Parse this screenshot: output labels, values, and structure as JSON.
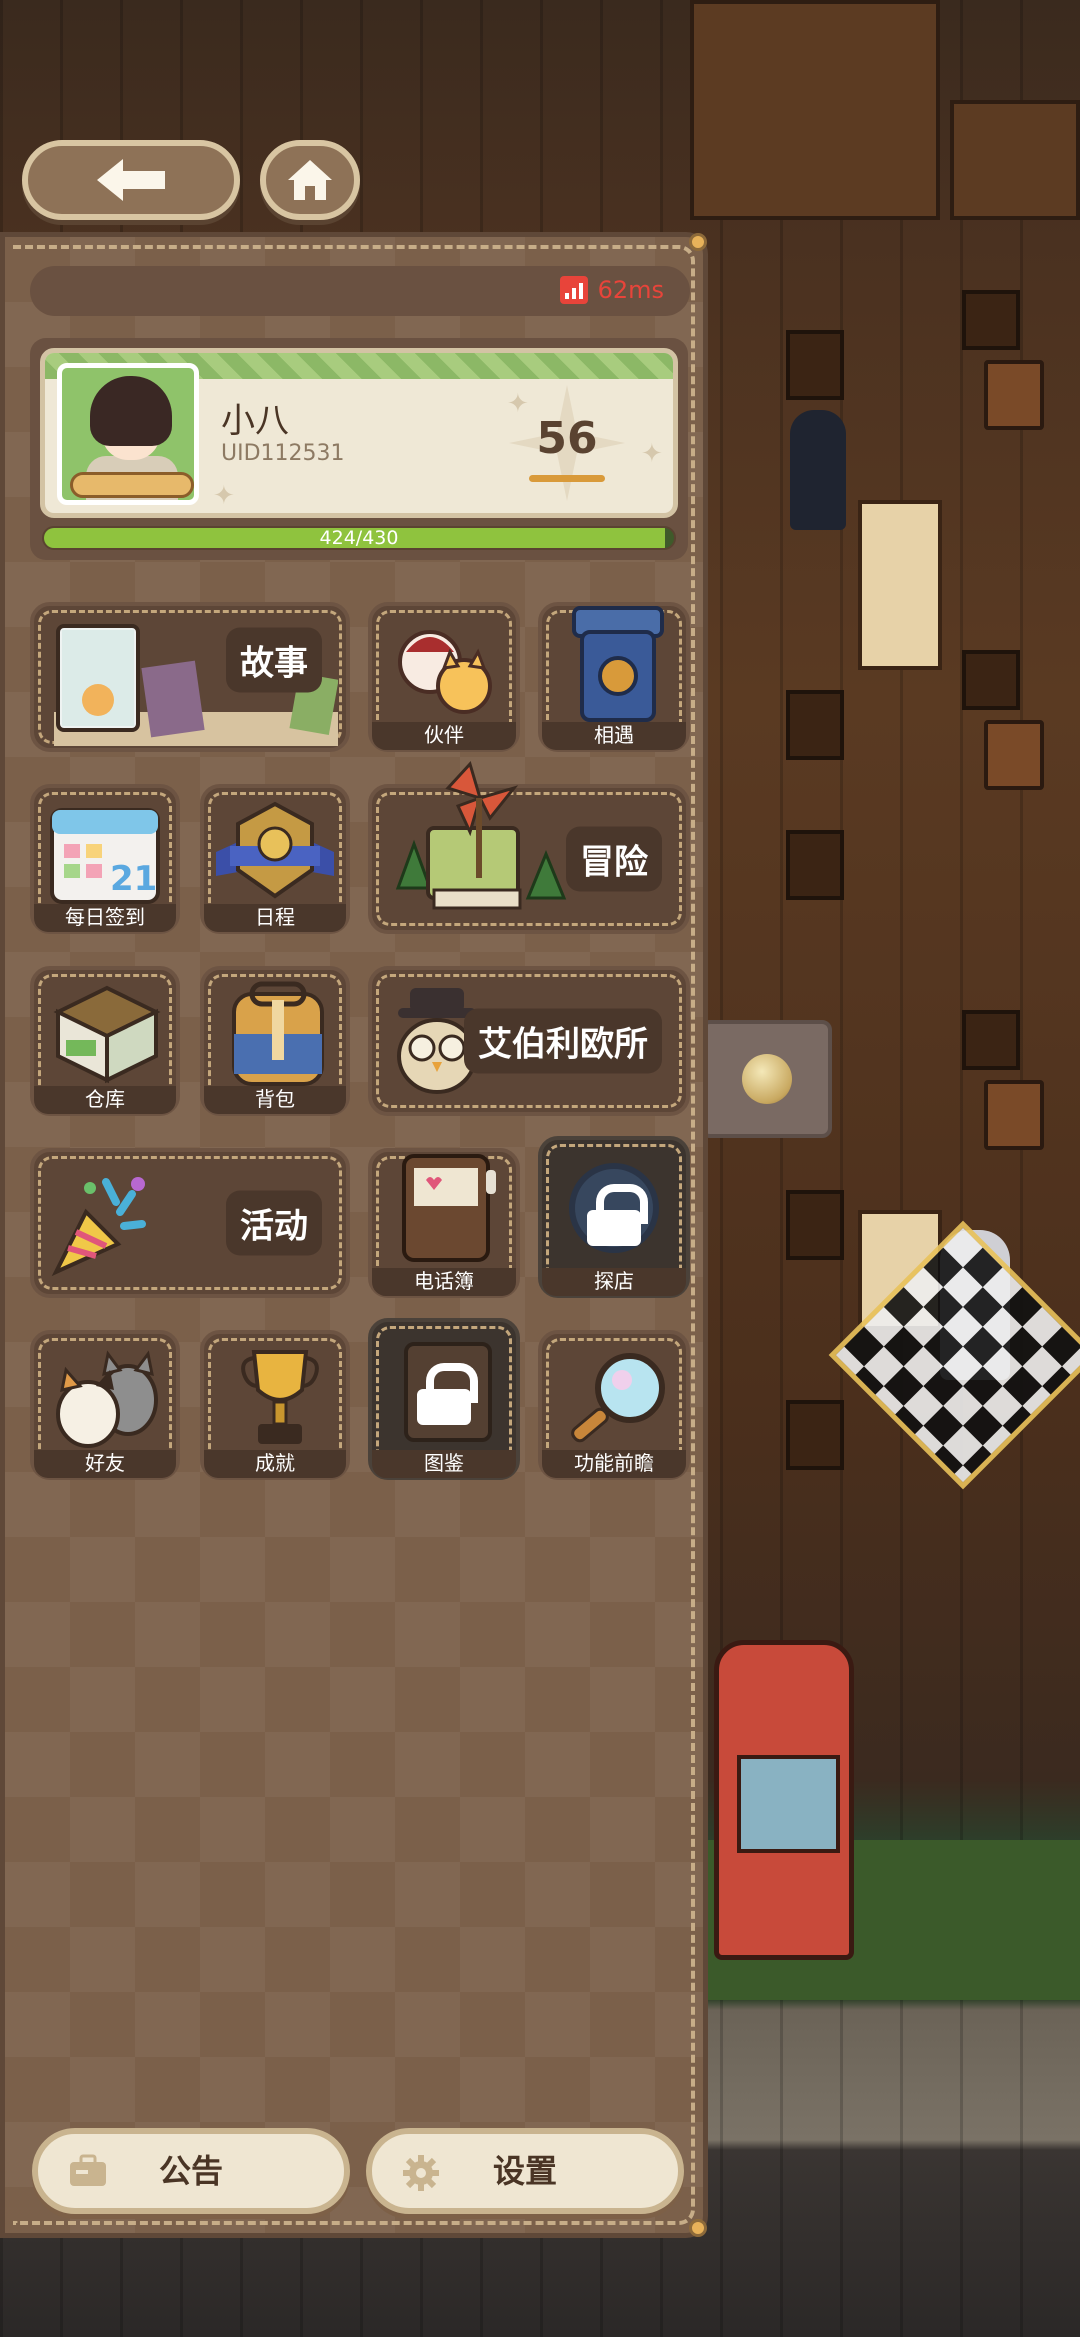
{
  "ping": {
    "value": "62ms",
    "color": "#e8443a"
  },
  "profile": {
    "name": "小八",
    "uid": "UID112531",
    "level": "56",
    "exp_text": "424/430",
    "exp_fraction": 0.986
  },
  "menu": {
    "story": "故事",
    "partner": "伙伴",
    "encounter": "相遇",
    "daily_checkin": "每日签到",
    "schedule": "日程",
    "adventure": "冒险",
    "warehouse": "仓库",
    "backpack": "背包",
    "abelio": "艾伯利欧所",
    "activity": "活动",
    "phonebook": "电话簿",
    "explore_store": "探店",
    "friends": "好友",
    "achievement": "成就",
    "codex": "图鉴",
    "preview": "功能前瞻"
  },
  "calendar_number": "21",
  "bottom": {
    "announcement": "公告",
    "settings": "设置"
  },
  "colors": {
    "panel": "#7b604a",
    "tile": "#5d4637",
    "accent_green": "#8fc33e",
    "label_bg": "#4a372b"
  }
}
